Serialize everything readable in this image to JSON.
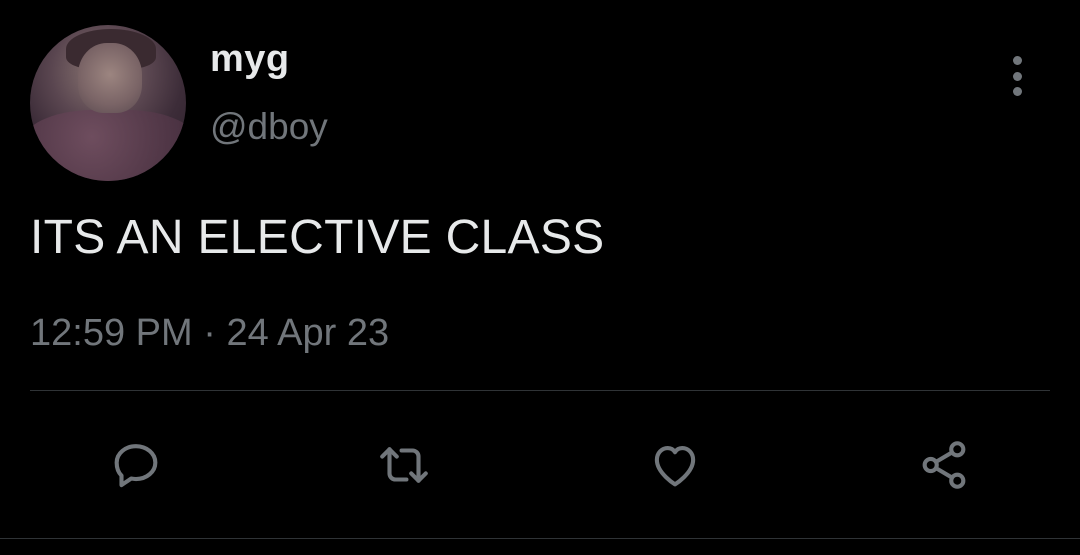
{
  "tweet": {
    "author": {
      "display_name": "myg",
      "handle": "@dboy",
      "avatar_icon": "profile-photo"
    },
    "text": "ITS AN ELECTIVE CLASS",
    "time": "12:59 PM",
    "separator": "·",
    "date": "24 Apr 23"
  },
  "actions": [
    {
      "name": "reply",
      "icon": "reply-icon"
    },
    {
      "name": "retweet",
      "icon": "retweet-icon"
    },
    {
      "name": "like",
      "icon": "heart-icon"
    },
    {
      "name": "share",
      "icon": "share-icon"
    }
  ],
  "colors": {
    "background": "#000000",
    "primary_text": "#e7e9ea",
    "secondary_text": "#71767b",
    "divider": "#2f3336"
  }
}
